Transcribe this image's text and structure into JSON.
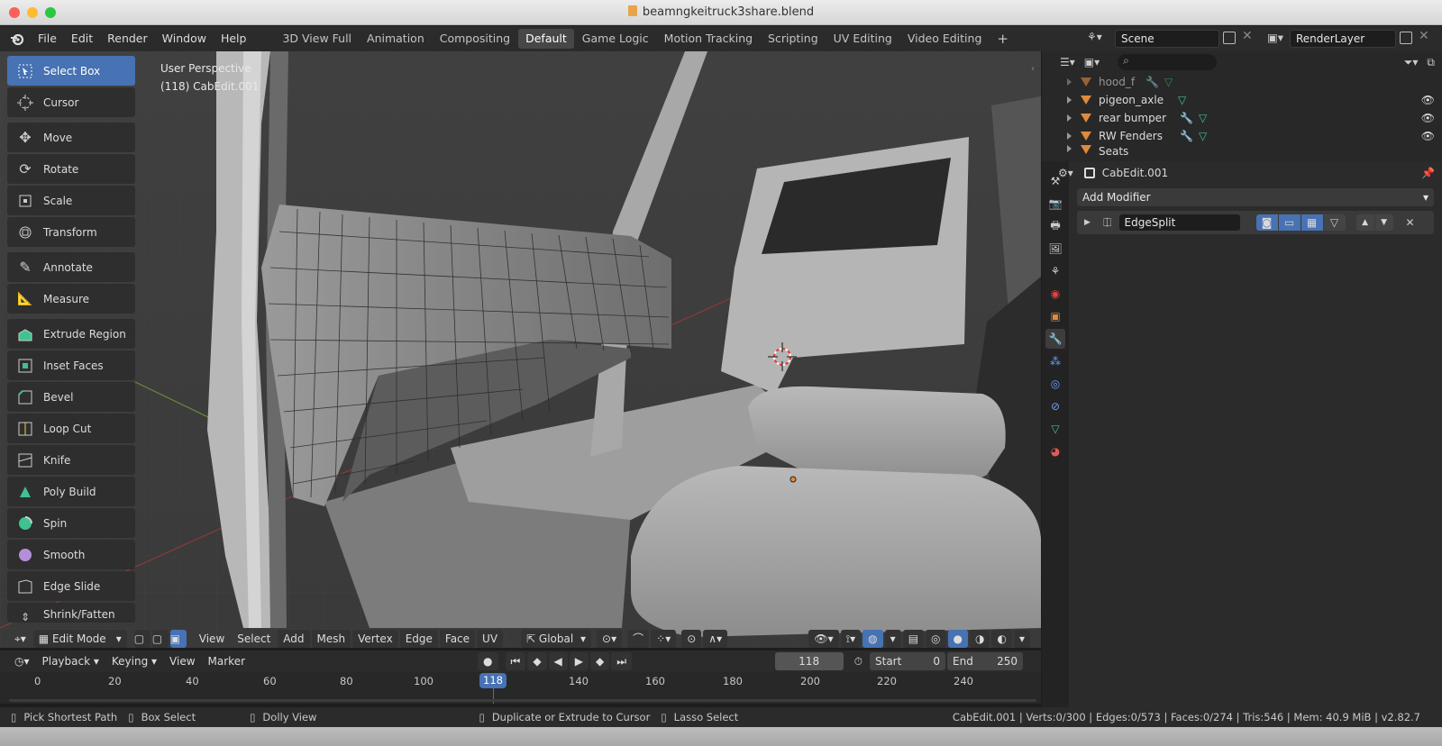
{
  "window": {
    "title": "beamngkeitruck3share.blend"
  },
  "menu": [
    "File",
    "Edit",
    "Render",
    "Window",
    "Help"
  ],
  "workspaces": [
    {
      "label": "3D View Full",
      "active": false
    },
    {
      "label": "Animation",
      "active": false
    },
    {
      "label": "Compositing",
      "active": false
    },
    {
      "label": "Default",
      "active": true
    },
    {
      "label": "Game Logic",
      "active": false
    },
    {
      "label": "Motion Tracking",
      "active": false
    },
    {
      "label": "Scripting",
      "active": false
    },
    {
      "label": "UV Editing",
      "active": false
    },
    {
      "label": "Video Editing",
      "active": false
    }
  ],
  "add_workspace": "+",
  "scene": {
    "name": "Scene",
    "render_layer": "RenderLayer"
  },
  "toolbar": [
    {
      "label": "Select Box",
      "icon": "select-box-icon",
      "active": true
    },
    {
      "label": "Cursor",
      "icon": "cursor-icon"
    },
    {
      "label": "Move",
      "icon": "move-icon"
    },
    {
      "label": "Rotate",
      "icon": "rotate-icon"
    },
    {
      "label": "Scale",
      "icon": "scale-icon"
    },
    {
      "label": "Transform",
      "icon": "transform-icon"
    },
    {
      "label": "Annotate",
      "icon": "annotate-icon"
    },
    {
      "label": "Measure",
      "icon": "measure-icon"
    },
    {
      "label": "Extrude Region",
      "icon": "extrude-icon"
    },
    {
      "label": "Inset Faces",
      "icon": "inset-icon"
    },
    {
      "label": "Bevel",
      "icon": "bevel-icon"
    },
    {
      "label": "Loop Cut",
      "icon": "loop-cut-icon"
    },
    {
      "label": "Knife",
      "icon": "knife-icon"
    },
    {
      "label": "Poly Build",
      "icon": "poly-build-icon"
    },
    {
      "label": "Spin",
      "icon": "spin-icon"
    },
    {
      "label": "Smooth",
      "icon": "smooth-icon"
    },
    {
      "label": "Edge Slide",
      "icon": "edge-slide-icon"
    },
    {
      "label": "Shrink/Fatten",
      "icon": "shrink-fatten-icon"
    }
  ],
  "viewport": {
    "perspective": "User Perspective",
    "object": "(118) CabEdit.001"
  },
  "viewport_header": {
    "mode": "Edit Mode",
    "menus": [
      "View",
      "Select",
      "Add",
      "Mesh",
      "Vertex",
      "Edge",
      "Face",
      "UV"
    ],
    "orientation": "Global"
  },
  "timeline": {
    "menus": [
      "Playback",
      "Keying",
      "View",
      "Marker"
    ],
    "current_frame": "118",
    "start_label": "Start",
    "start": "0",
    "end_label": "End",
    "end": "250",
    "ticks": [
      "0",
      "20",
      "40",
      "60",
      "80",
      "100",
      "140",
      "160",
      "180",
      "200",
      "220",
      "240"
    ]
  },
  "outliner": {
    "items": [
      {
        "name": "hood_f"
      },
      {
        "name": "pigeon_axle"
      },
      {
        "name": "rear bumper"
      },
      {
        "name": "RW Fenders"
      },
      {
        "name": "Seats"
      }
    ]
  },
  "properties": {
    "object": "CabEdit.001",
    "add_modifier": "Add Modifier",
    "modifier_name": "EdgeSplit"
  },
  "status": {
    "hint1": "Pick Shortest Path",
    "hint2": "Box Select",
    "hint3": "Dolly View",
    "hint4": "Duplicate or Extrude to Cursor",
    "hint5": "Lasso Select",
    "stats": "CabEdit.001 | Verts:0/300 | Edges:0/573 | Faces:0/274 | Tris:546 | Mem: 40.9 MiB | v2.82.7"
  },
  "colors": {
    "accent": "#4772b3",
    "object_orange": "#e08a3c",
    "mesh_green": "#3ec28f"
  }
}
